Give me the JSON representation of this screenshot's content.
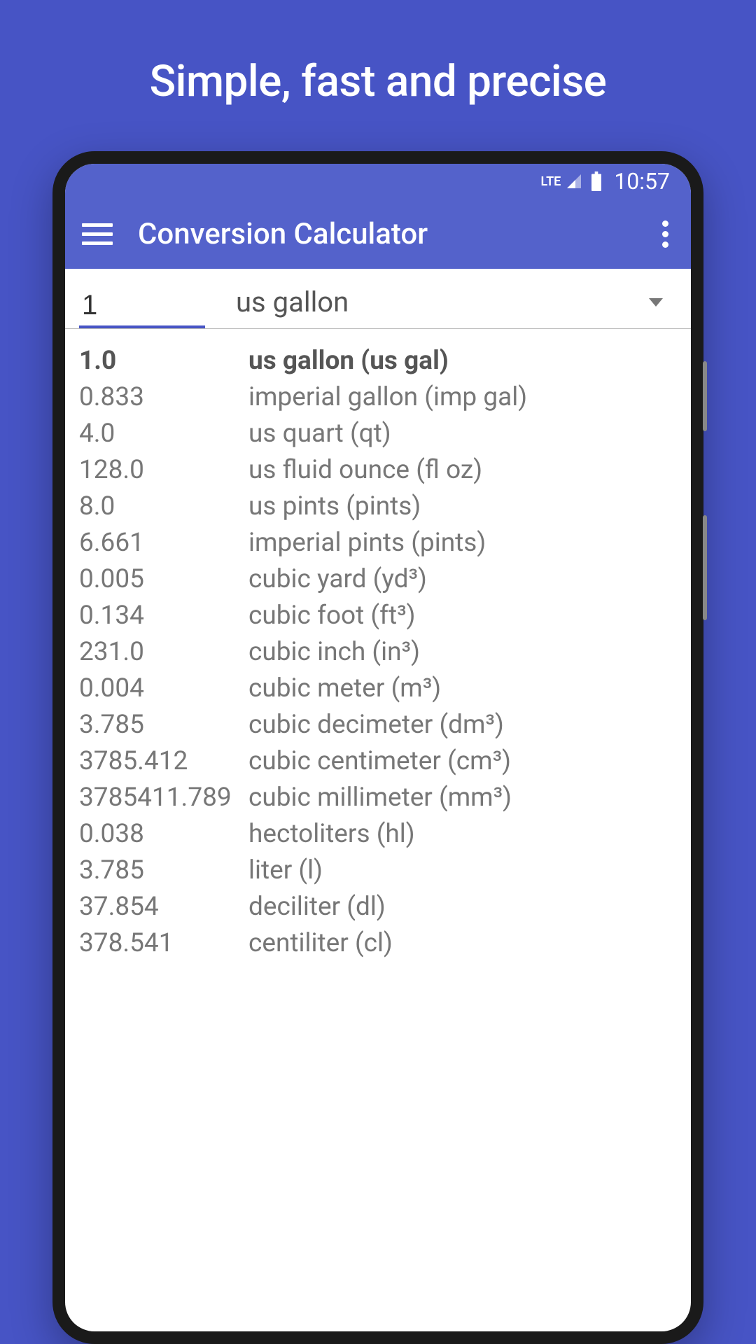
{
  "marketing": {
    "headline": "Simple, fast and precise"
  },
  "status_bar": {
    "network": "LTE",
    "time": "10:57"
  },
  "app_bar": {
    "title": "Conversion Calculator"
  },
  "input": {
    "quantity": "1",
    "selected_unit": "us gallon"
  },
  "results": [
    {
      "value": "1.0",
      "unit": "us gallon (us gal)",
      "highlighted": true
    },
    {
      "value": "0.833",
      "unit": "imperial gallon (imp gal)",
      "highlighted": false
    },
    {
      "value": "4.0",
      "unit": "us quart (qt)",
      "highlighted": false
    },
    {
      "value": "128.0",
      "unit": "us fluid ounce (fl oz)",
      "highlighted": false
    },
    {
      "value": "8.0",
      "unit": "us pints (pints)",
      "highlighted": false
    },
    {
      "value": "6.661",
      "unit": "imperial pints (pints)",
      "highlighted": false
    },
    {
      "value": "0.005",
      "unit": "cubic yard (yd³)",
      "highlighted": false
    },
    {
      "value": "0.134",
      "unit": "cubic foot (ft³)",
      "highlighted": false
    },
    {
      "value": "231.0",
      "unit": "cubic inch (in³)",
      "highlighted": false
    },
    {
      "value": "0.004",
      "unit": "cubic meter (m³)",
      "highlighted": false
    },
    {
      "value": "3.785",
      "unit": "cubic decimeter (dm³)",
      "highlighted": false
    },
    {
      "value": "3785.412",
      "unit": "cubic centimeter (cm³)",
      "highlighted": false
    },
    {
      "value": "3785411.789",
      "unit": "cubic millimeter (mm³)",
      "highlighted": false
    },
    {
      "value": "0.038",
      "unit": "hectoliters (hl)",
      "highlighted": false
    },
    {
      "value": "3.785",
      "unit": "liter (l)",
      "highlighted": false
    },
    {
      "value": "37.854",
      "unit": "deciliter (dl)",
      "highlighted": false
    },
    {
      "value": "378.541",
      "unit": "centiliter (cl)",
      "highlighted": false
    }
  ]
}
